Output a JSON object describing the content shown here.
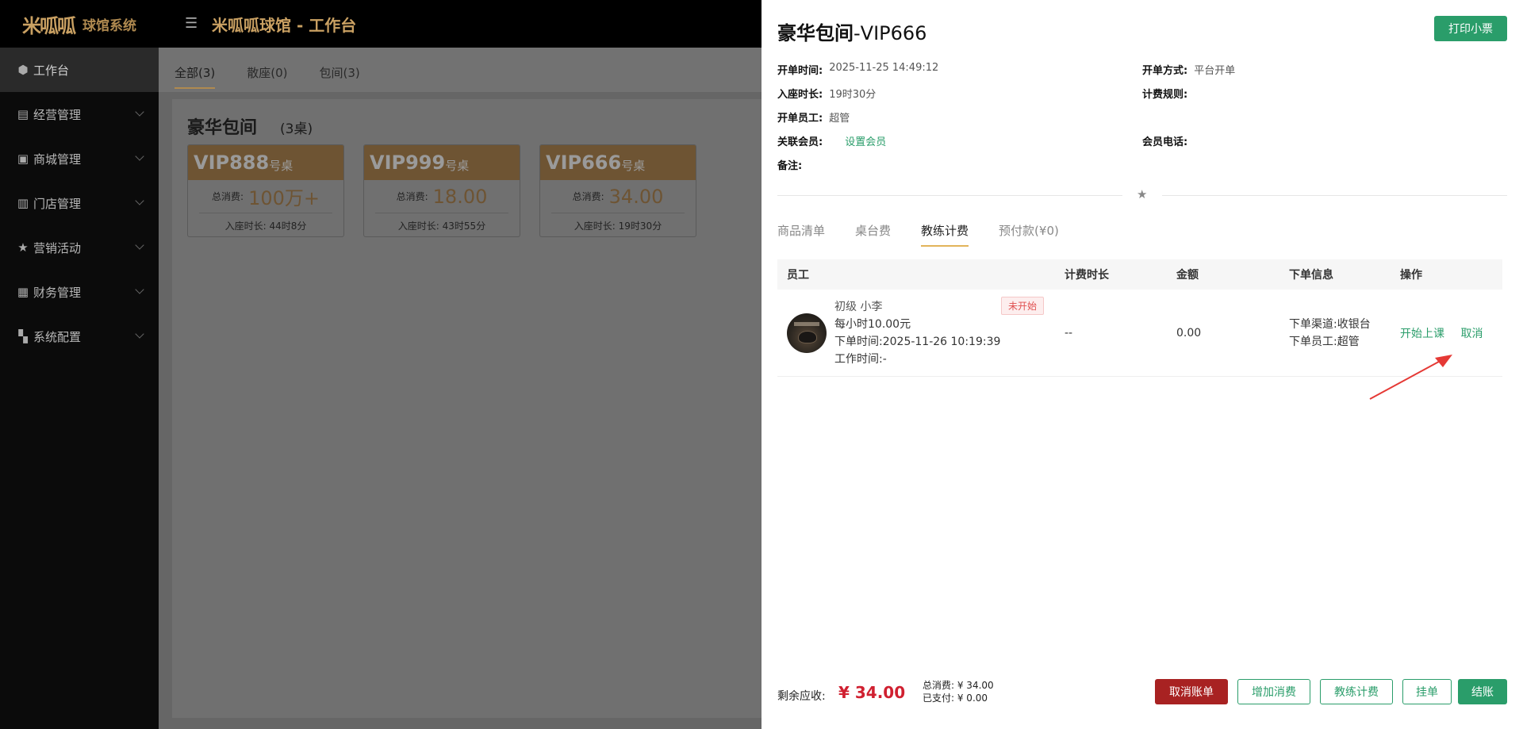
{
  "app": {
    "logo_mark": "米呱呱",
    "logo_text": "球馆系统",
    "title": "米呱呱球馆 - 工作台"
  },
  "sidebar": {
    "items": [
      {
        "label": "工作台",
        "icon": "cube-icon"
      },
      {
        "label": "经营管理",
        "icon": "chart-icon"
      },
      {
        "label": "商城管理",
        "icon": "shop-icon"
      },
      {
        "label": "门店管理",
        "icon": "store-icon"
      },
      {
        "label": "营销活动",
        "icon": "star-icon"
      },
      {
        "label": "财务管理",
        "icon": "finance-icon"
      },
      {
        "label": "系统配置",
        "icon": "grid-icon"
      }
    ]
  },
  "main": {
    "tabs": [
      "全部(3)",
      "散座(0)",
      "包间(3)"
    ],
    "section_title": "豪华包间",
    "section_count": "(3桌)",
    "cards": [
      {
        "name": "VIP888",
        "suffix": "号桌",
        "total_label": "总消费:",
        "total": "100万+",
        "time": "入座时长: 44时8分"
      },
      {
        "name": "VIP999",
        "suffix": "号桌",
        "total_label": "总消费:",
        "total": "18.00",
        "time": "入座时长: 43时55分"
      },
      {
        "name": "VIP666",
        "suffix": "号桌",
        "total_label": "总消费:",
        "total": "34.00",
        "time": "入座时长: 19时30分"
      }
    ]
  },
  "drawer": {
    "title_bold": "豪华包间",
    "title_rest": "-VIP666",
    "print_label": "打印小票",
    "info": {
      "open_time_label": "开单时间:",
      "open_time": "2025-11-25 14:49:12",
      "open_mode_label": "开单方式:",
      "open_mode": "平台开单",
      "seat_label": "入座时长:",
      "seat": "19时30分",
      "rule_label": "计费规则:",
      "staff_label": "开单员工:",
      "staff": "超管",
      "member_label": "关联会员:",
      "member_link": "设置会员",
      "phone_label": "会员电话:",
      "remark_label": "备注:"
    },
    "tabs": [
      "商品清单",
      "桌台费",
      "教练计费",
      "预付款(¥0)"
    ],
    "table": {
      "headers": [
        "员工",
        "计费时长",
        "金额",
        "下单信息",
        "操作"
      ],
      "row": {
        "name": "初级 小李",
        "rate": "每小时10.00元",
        "order_time": "下单时间:2025-11-26 10:19:39",
        "work_time": "工作时间:-",
        "status": "未开始",
        "duration": "--",
        "amount": "0.00",
        "channel": "下单渠道:收银台",
        "order_staff": "下单员工:超管",
        "op_start": "开始上课",
        "op_cancel": "取消"
      }
    },
    "footer": {
      "remain_label": "剩余应收:",
      "remain_value": "¥ 34.00",
      "total_line": "总消费: ¥ 34.00",
      "paid_line": "已支付: ¥ 0.00",
      "btn_cancel_bill": "取消账单",
      "btn_add": "增加消费",
      "btn_coach": "教练计费",
      "btn_hang": "挂单",
      "btn_checkout": "结账"
    }
  },
  "colors": {
    "accent_green": "#2a9d6a",
    "danger_red": "#a82222",
    "gold": "#c9a062"
  }
}
